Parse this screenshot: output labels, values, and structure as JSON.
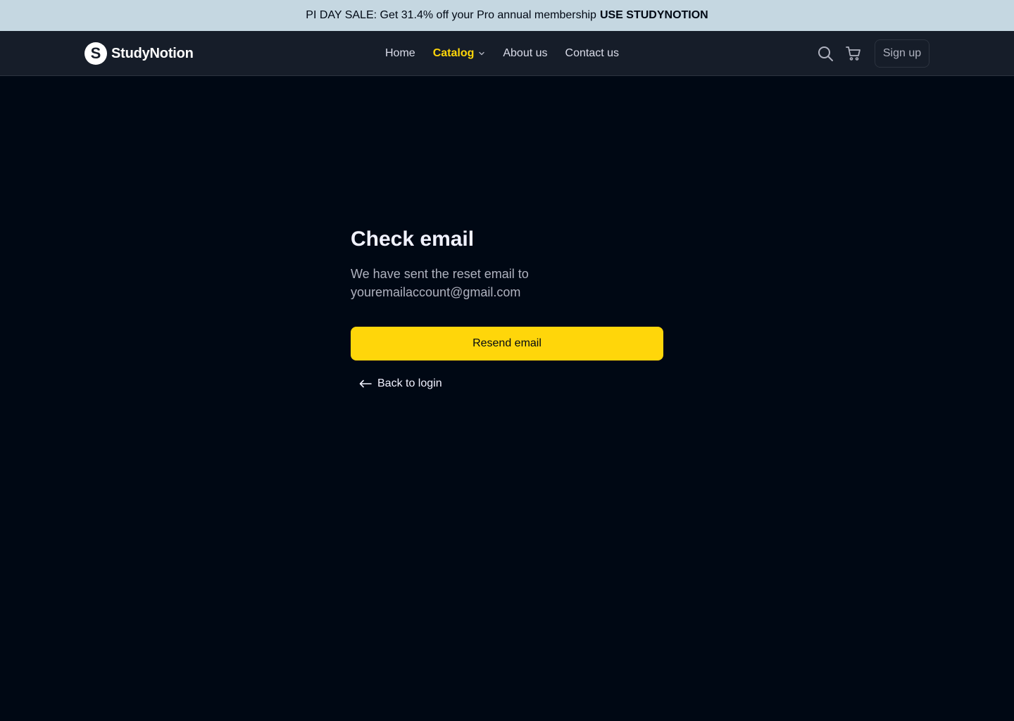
{
  "promo": {
    "text": "PI DAY SALE: Get 31.4% off your Pro annual membership",
    "code": "USE STUDYNOTION"
  },
  "brand": {
    "mark": "S",
    "name": "StudyNotion"
  },
  "nav": {
    "links": [
      {
        "label": "Home"
      },
      {
        "label": "Catalog",
        "active": true
      },
      {
        "label": "About us"
      },
      {
        "label": "Contact us"
      }
    ],
    "search_icon": "search-icon",
    "cart_icon": "cart-icon",
    "signup_label": "Sign up"
  },
  "main": {
    "title": "Check email",
    "description_line1": "We have sent the reset email to",
    "email": "youremailaccount@gmail.com",
    "resend_label": "Resend email",
    "back_label": "Back to login"
  },
  "colors": {
    "accent": "#FFD60A",
    "background": "#000814",
    "navbar": "#161D29",
    "promo_bar": "#C5D7E1"
  }
}
